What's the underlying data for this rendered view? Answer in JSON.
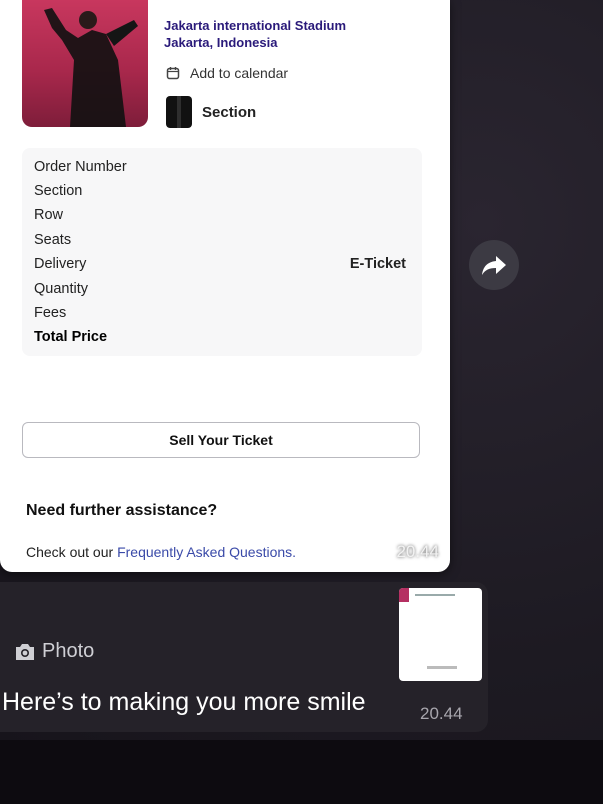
{
  "ticket": {
    "venue_line1": "Jakarta international Stadium",
    "venue_line2": "Jakarta, Indonesia",
    "add_to_calendar": "Add to calendar",
    "section_label": "Section",
    "details": [
      {
        "label": "Order Number",
        "value": ""
      },
      {
        "label": "Section",
        "value": ""
      },
      {
        "label": "Row",
        "value": ""
      },
      {
        "label": "Seats",
        "value": ""
      },
      {
        "label": "Delivery",
        "value": "E-Ticket"
      },
      {
        "label": "Quantity",
        "value": ""
      },
      {
        "label": "Fees",
        "value": ""
      },
      {
        "label": "Total Price",
        "value": ""
      }
    ],
    "sell_button": "Sell Your Ticket",
    "assist_heading": "Need further assistance?",
    "faq_prefix": "Check out our ",
    "faq_link": "Frequently Asked Questions."
  },
  "chat": {
    "msg1_time": "20.44",
    "msg2_photo_label": "Photo",
    "msg2_caption": "Here’s to making you more smile",
    "msg2_time": "20.44"
  },
  "colors": {
    "venue_text": "#2a1a7a",
    "chat_bubble": "#252229",
    "poster": "#c8375e"
  },
  "icons": [
    "calendar-icon",
    "seat-icon",
    "forward-icon",
    "camera-icon"
  ]
}
